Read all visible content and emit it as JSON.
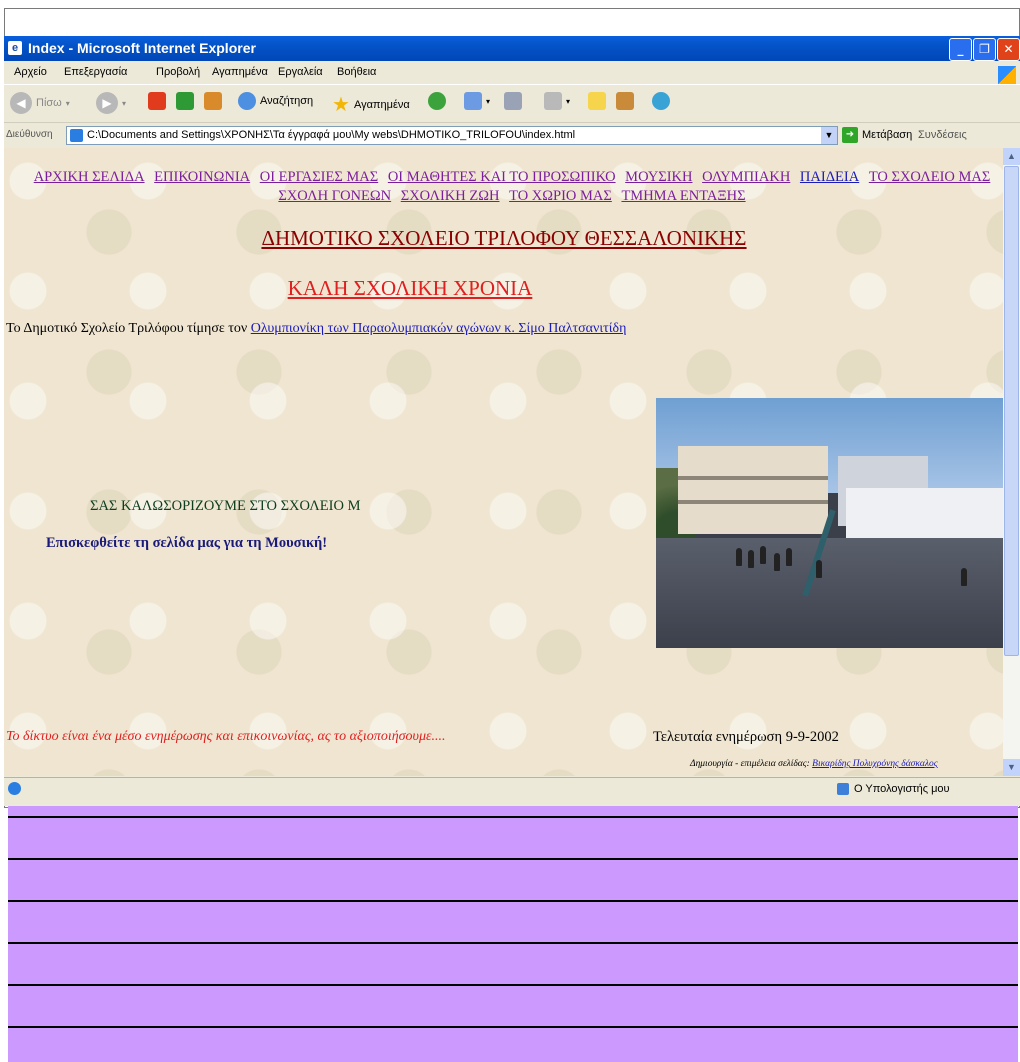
{
  "window": {
    "title": "Index - Microsoft Internet Explorer",
    "min_glyph": "_",
    "max_glyph": "❐",
    "close_glyph": "✕"
  },
  "menu": [
    "Αρχείο",
    "Επεξεργασία",
    "Προβολή",
    "Αγαπημένα",
    "Εργαλεία",
    "Βοήθεια"
  ],
  "toolbar": {
    "back_label": "Πίσω",
    "search_label": "Αναζήτηση",
    "favorites_label": "Αγαπημένα"
  },
  "address": {
    "label": "Διεύθυνση",
    "value": "C:\\Documents and Settings\\ΧΡΟΝΗΣ\\Τα έγγραφά μου\\My webs\\DHMOTIKO_TRILOFOU\\index.html",
    "go_label": "Μετάβαση",
    "links_label": "Συνδέσεις"
  },
  "nav_links": [
    {
      "label": "ΑΡΧΙΚΗ ΣΕΛΙΔΑ",
      "color": "purple"
    },
    {
      "label": "ΕΠΙΚΟΙΝΩΝΙΑ",
      "color": "purple"
    },
    {
      "label": "ΟΙ ΕΡΓΑΣΙΕΣ ΜΑΣ",
      "color": "purple"
    },
    {
      "label": "ΟΙ ΜΑΘΗΤΕΣ ΚΑΙ ΤΟ ΠΡΟΣΩΠΙΚΟ",
      "color": "purple"
    },
    {
      "label": "ΜΟΥΣΙΚΗ",
      "color": "purple"
    },
    {
      "label": "ΟΛΥΜΠΙΑΚΗ",
      "color": "purple"
    },
    {
      "label": "ΠΑΙΔΕΙΑ",
      "color": "blue"
    },
    {
      "label": "ΤΟ ΣΧΟΛΕΙΟ ΜΑΣ",
      "color": "purple"
    },
    {
      "label": "ΣΧΟΛΗ ΓΟΝΕΩΝ",
      "color": "purple"
    },
    {
      "label": "ΣΧΟΛΙΚΗ ΖΩΗ",
      "color": "purple"
    },
    {
      "label": "ΤΟ ΧΩΡΙΟ ΜΑΣ",
      "color": "purple"
    },
    {
      "label": "ΤΜΗΜΑ ΕΝΤΑΞΗΣ",
      "color": "purple"
    }
  ],
  "page": {
    "heading": "ΔΗΜΟΤΙΚΟ ΣΧΟΛΕΙΟ ΤΡΙΛΟΦΟΥ ΘΕΣΣΑΛΟΝΙΚΗΣ",
    "subheading": "ΚΑΛΗ ΣΧΟΛΙΚΗ ΧΡΟΝΙΑ",
    "intro_text": "Το Δημοτικό Σχολείο Τριλόφου τίμησε τον ",
    "intro_link": "Ολυμπιονίκη των Παραολυμπιακών αγώνων κ. Σίμο Παλτσανιτίδη",
    "welcome": "ΣΑΣ ΚΑΛΩΣΟΡΙΖΟΥΜΕ ΣΤΟ ΣΧΟΛΕΙΟ Μ",
    "visit": "Επισκεφθείτε τη σελίδα μας για τη  Μουσική!",
    "footer_note": "Το δίκτυο είναι ένα μέσο ενημέρωσης και επικοινωνίας, ας το αξιοποιήσουμε....",
    "last_update": "Τελευταία ενημέρωση  9-9-2002",
    "creator_label": "Δημιουργία - επιμέλεια σελίδας: ",
    "creator_link": "Βικαρίδης Πολυχρόνης  δάσκαλος"
  },
  "status": {
    "zone": "Ο Υπολογιστής μου"
  },
  "colors": {
    "nav_purple": "#7b1e9e",
    "nav_blue": "#1b1bb8",
    "heading": "#8b0000",
    "subheading": "#e02020",
    "stripe_fill": "#cc99ff"
  }
}
